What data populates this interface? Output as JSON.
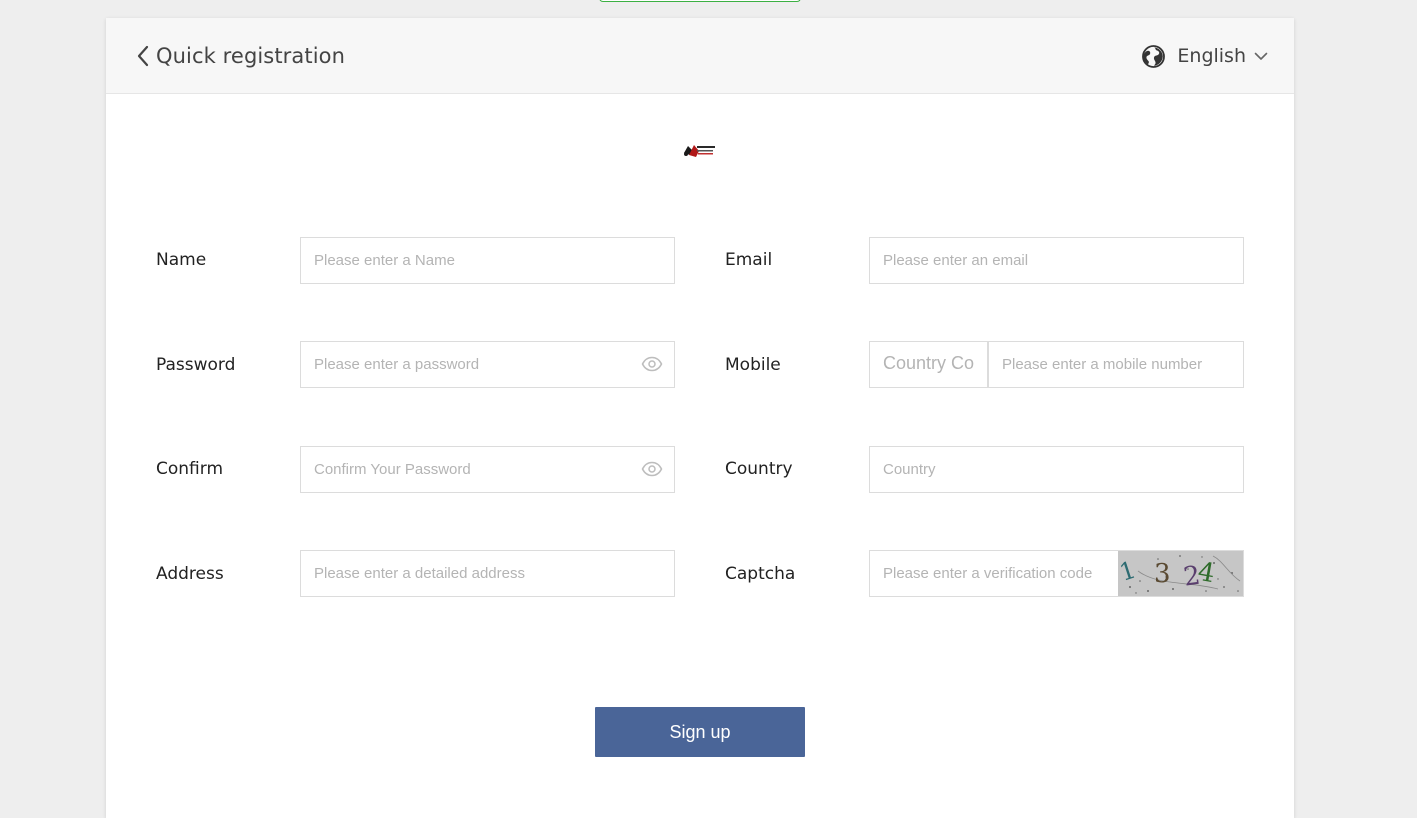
{
  "header": {
    "title": "Quick registration",
    "language": "English"
  },
  "form": {
    "name_label": "Name",
    "name_placeholder": "Please enter a Name",
    "email_label": "Email",
    "email_placeholder": "Please enter an email",
    "password_label": "Password",
    "password_placeholder": "Please enter a password",
    "mobile_label": "Mobile",
    "country_code_placeholder": "Country Code",
    "mobile_placeholder": "Please enter a mobile number",
    "confirm_label": "Confirm",
    "confirm_placeholder": "Confirm Your Password",
    "country_label": "Country",
    "country_placeholder": "Country",
    "address_label": "Address",
    "address_placeholder": "Please enter a detailed address",
    "captcha_label": "Captcha",
    "captcha_placeholder": "Please enter a verification code",
    "captcha_code": "1324"
  },
  "submit_label": "Sign up",
  "colors": {
    "button": "#4a6598",
    "header_bg": "#f7f7f7",
    "border": "#dcdcdc"
  },
  "icons": {
    "back": "chevron-left-icon",
    "language": "globe-icon",
    "language_dropdown": "chevron-down-icon",
    "password_toggle": "eye-icon"
  }
}
